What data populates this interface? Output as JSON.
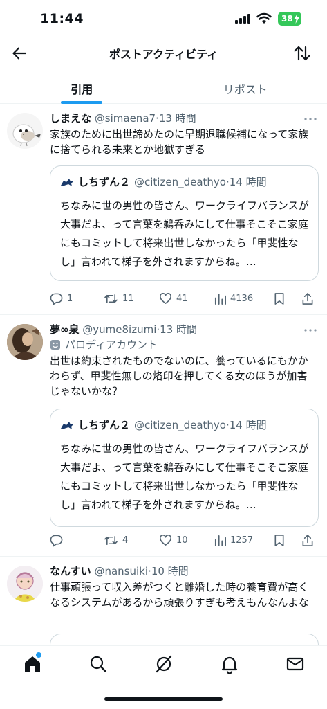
{
  "status_bar": {
    "time": "11:44",
    "battery": "38"
  },
  "header": {
    "title": "ポストアクティビティ"
  },
  "tabs": [
    {
      "label": "引用",
      "active": true
    },
    {
      "label": "リポスト",
      "active": false
    }
  ],
  "posts": [
    {
      "name": "しまえな",
      "handle": "@simaena7",
      "time": "·13 時間",
      "text": "家族のために出世諦めたのに早期退職候補になって家族に捨てられる未来とか地獄すぎる",
      "quote": {
        "name": "しちずん２",
        "handle": "@citizen_deathyo",
        "time": "·14 時間",
        "text": "ちなみに世の男性の皆さん、ワークライフバランスが大事だよ、って言葉を鵜呑みにして仕事そこそこ家庭にもコミットして将来出世しなかったら「甲斐性なし」言われて梯子を外されますからね。…"
      },
      "replies": "1",
      "reposts": "11",
      "likes": "41",
      "views": "4136"
    },
    {
      "name": "夢∞泉",
      "handle": "@yume8izumi",
      "time": "·13 時間",
      "parody_label": "パロディアカウント",
      "text": "出世は約束されたものでないのに、養っているにもかかわらず、甲斐性無しの烙印を押してくる女のほうが加害じゃないかな？",
      "quote": {
        "name": "しちずん２",
        "handle": "@citizen_deathyo",
        "time": "·14 時間",
        "text": "ちなみに世の男性の皆さん、ワークライフバランスが大事だよ、って言葉を鵜呑みにして仕事そこそこ家庭にもコミットして将来出世しなかったら「甲斐性なし」言われて梯子を外されますからね。…"
      },
      "replies": "",
      "reposts": "4",
      "likes": "10",
      "views": "1257"
    },
    {
      "name": "なんすい",
      "handle": "@nansuiki",
      "time": "·10 時間",
      "text": "仕事頑張って収入差がつくと離婚した時の養育費が高くなるシステムがあるから頑張りすぎも考えもんなんよな"
    }
  ],
  "colors": {
    "accent": "#1d9bf0",
    "secondary_text": "#536471",
    "border": "#cfd9de"
  },
  "nav_icons": [
    "home-icon",
    "search-icon",
    "grok-icon",
    "notifications-icon",
    "messages-icon"
  ]
}
